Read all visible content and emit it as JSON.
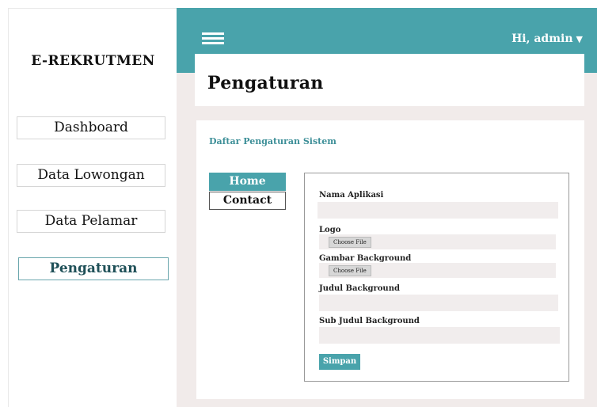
{
  "sidebar": {
    "brand": "E-REKRUTMEN",
    "items": [
      {
        "label": "Dashboard"
      },
      {
        "label": "Data Lowongan"
      },
      {
        "label": "Data Pelamar"
      },
      {
        "label": "Pengaturan",
        "active": true
      }
    ]
  },
  "topbar": {
    "menu_icon": "hamburger-icon",
    "user_greeting": "Hi, admin",
    "caret": "▼"
  },
  "page": {
    "title": "Pengaturan"
  },
  "card": {
    "title": "Daftar Pengaturan Sistem",
    "tabs": [
      {
        "label": "Home",
        "active": true
      },
      {
        "label": "Contact"
      }
    ],
    "form": {
      "nama_aplikasi_label": "Nama Aplikasi",
      "nama_aplikasi_value": "",
      "logo_label": "Logo",
      "logo_button": "Choose File",
      "gambar_background_label": "Gambar Background",
      "gambar_background_button": "Choose File",
      "judul_background_label": "Judul Background",
      "judul_background_value": "",
      "sub_judul_background_label": "Sub Judul Background",
      "sub_judul_background_value": "",
      "save_label": "Simpan"
    }
  },
  "colors": {
    "accent": "#49a3ab",
    "accent_text": "#3d8f98",
    "background": "#f1ebea"
  }
}
